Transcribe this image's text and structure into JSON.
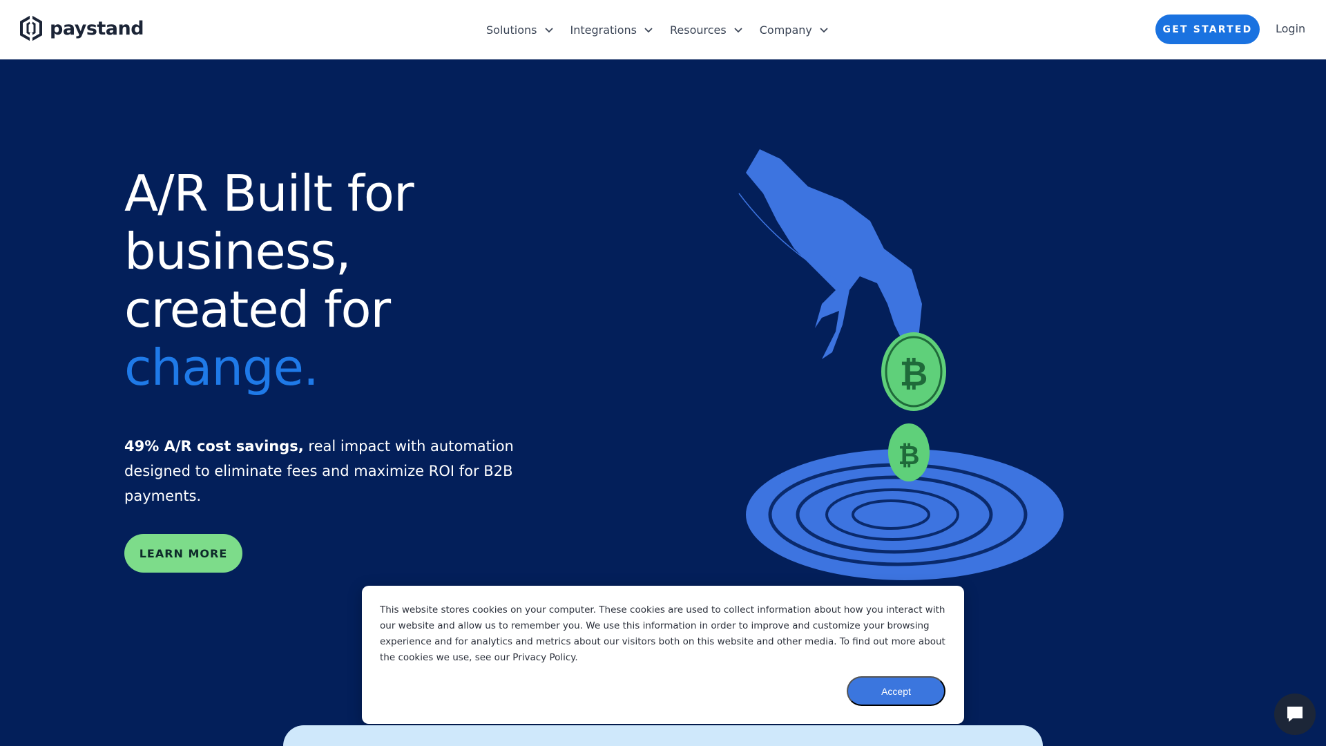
{
  "header": {
    "logo_text": "paystand",
    "nav": [
      {
        "label": "Solutions"
      },
      {
        "label": "Integrations"
      },
      {
        "label": "Resources"
      },
      {
        "label": "Company"
      }
    ],
    "get_started": "GET STARTED",
    "login": "Login"
  },
  "hero": {
    "title_line1": "A/R Built for",
    "title_line2": "business,",
    "title_line3": "created for",
    "title_accent": "change.",
    "subtitle_bold": "49% A/R cost savings,",
    "subtitle_rest": " real impact with automation designed to eliminate fees and maximize ROI for B2B payments.",
    "learn_more": "LEARN MORE"
  },
  "cookie": {
    "text": "This website stores cookies on your computer. These cookies are used to collect information about how you interact with our website and allow us to remember you. We use this information in order to improve and customize your browsing experience and for analytics and metrics about our visitors both on this website and other media. To find out more about the cookies we use, see our Privacy Policy.",
    "accept": "Accept"
  },
  "colors": {
    "hero_bg": "#031f5a",
    "accent_blue": "#1f7ae8",
    "cta_blue": "#1a72e0",
    "learn_more_green": "#7ddc8a",
    "coin_green": "#5fd07a",
    "art_blue": "#3d74e0"
  },
  "icons": {
    "logo": "paystand-hexagon-logo",
    "chevron": "chevron-down-icon",
    "chat": "chat-bubble-icon"
  }
}
